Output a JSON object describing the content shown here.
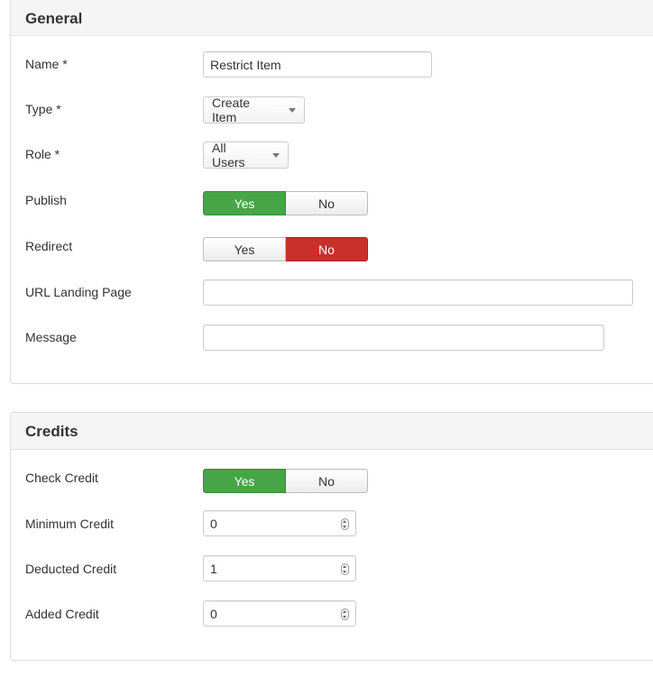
{
  "general": {
    "title": "General",
    "name": {
      "label": "Name *",
      "value": "Restrict Item"
    },
    "type": {
      "label": "Type *",
      "value": "Create Item"
    },
    "role": {
      "label": "Role *",
      "value": "All Users"
    },
    "publish": {
      "label": "Publish",
      "yes": "Yes",
      "no": "No",
      "selected": "Yes"
    },
    "redirect": {
      "label": "Redirect",
      "yes": "Yes",
      "no": "No",
      "selected": "No"
    },
    "url_landing_page": {
      "label": "URL Landing Page",
      "value": ""
    },
    "message": {
      "label": "Message",
      "value": ""
    }
  },
  "credits": {
    "title": "Credits",
    "check_credit": {
      "label": "Check Credit",
      "yes": "Yes",
      "no": "No",
      "selected": "Yes"
    },
    "minimum_credit": {
      "label": "Minimum Credit",
      "value": "0"
    },
    "deducted_credit": {
      "label": "Deducted Credit",
      "value": "1"
    },
    "added_credit": {
      "label": "Added Credit",
      "value": "0"
    }
  },
  "colors": {
    "yes_active": "#46a546",
    "no_active": "#c9302c",
    "header_bg": "#f5f5f5"
  }
}
